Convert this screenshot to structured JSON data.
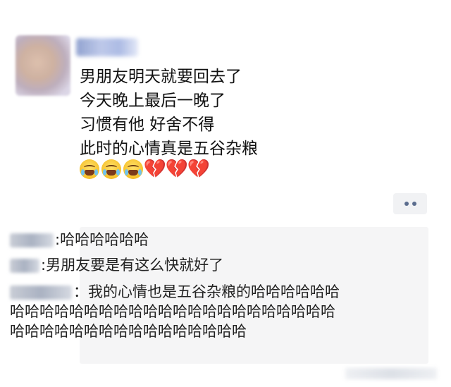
{
  "post": {
    "lines": [
      "男朋友明天就要回去了",
      "今天晚上最后一晚了",
      "习惯有他 好舍不得",
      "此时的心情真是五谷杂粮"
    ],
    "emojis": [
      "crying-face-icon",
      "crying-face-icon",
      "crying-face-icon",
      "broken-heart-icon",
      "broken-heart-icon",
      "broken-heart-icon"
    ],
    "broken_heart_glyph": "💔",
    "heart_color": "#e06a1e"
  },
  "actions": {
    "more_icon": "more-dots-icon"
  },
  "comments": [
    {
      "separator": ":",
      "text": "哈哈哈哈哈哈"
    },
    {
      "separator": ":",
      "text": "男朋友要是有这么快就好了"
    },
    {
      "separator": "：",
      "text": "我的心情也是五谷杂粮的哈哈哈哈哈哈哈哈哈哈哈哈哈哈哈哈哈哈哈哈哈哈哈哈哈哈哈哈哈哈哈哈哈哈哈哈哈哈哈哈哈哈哈哈"
    }
  ]
}
